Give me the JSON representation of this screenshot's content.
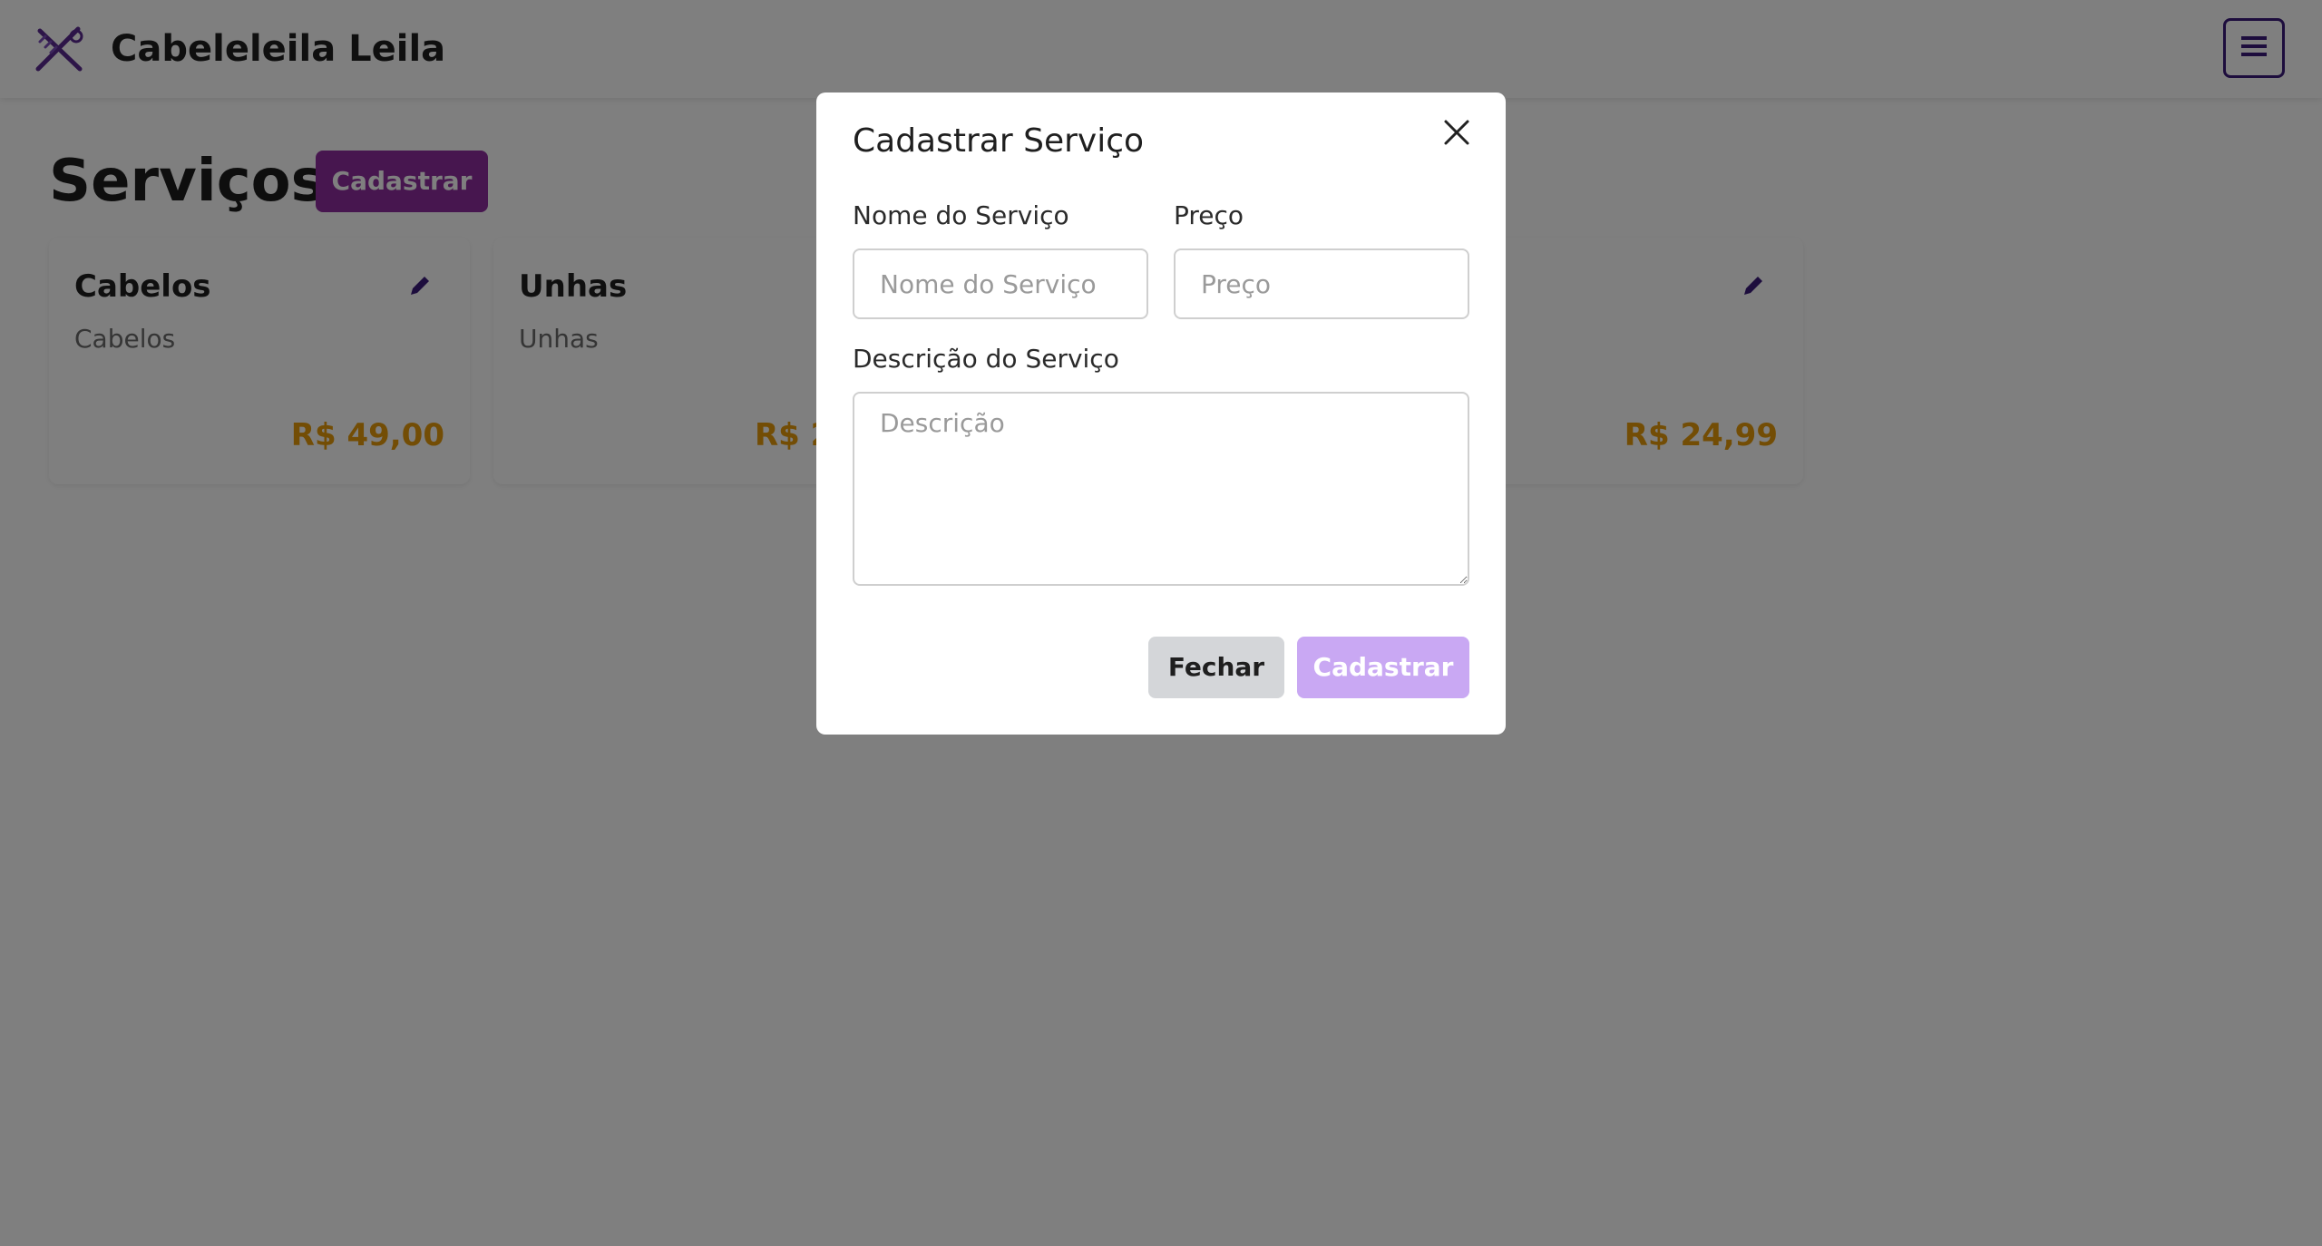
{
  "navbar": {
    "brand_name": "Cabeleleila Leila",
    "brand_icon": "scissors-comb-icon",
    "menu_icon": "hamburger-menu-icon"
  },
  "page": {
    "title": "Serviços",
    "register_label": "Cadastrar"
  },
  "cards": [
    {
      "title": "Cabelos",
      "description": "Cabelos",
      "price": "R$ 49,00"
    },
    {
      "title": "Unhas",
      "description": "Unhas",
      "price": "R$ 2"
    },
    {
      "title": "",
      "description": "",
      "price": "R$ 24,99"
    }
  ],
  "modal": {
    "title": "Cadastrar Serviço",
    "name_label": "Nome do Serviço",
    "name_placeholder": "Nome do Serviço",
    "name_value": "",
    "price_label": "Preço",
    "price_placeholder": "Preço",
    "price_value": "",
    "description_label": "Descrição do Serviço",
    "description_placeholder": "Descrição",
    "description_value": "",
    "close_label": "Fechar",
    "submit_label": "Cadastrar"
  },
  "colors": {
    "brand_purple": "#8e2c9e",
    "dark_purple": "#3b1a7a",
    "price_orange": "#e69a0a",
    "submit_disabled": "#c9a8f3",
    "overlay": "rgba(0,0,0,0.5)"
  }
}
